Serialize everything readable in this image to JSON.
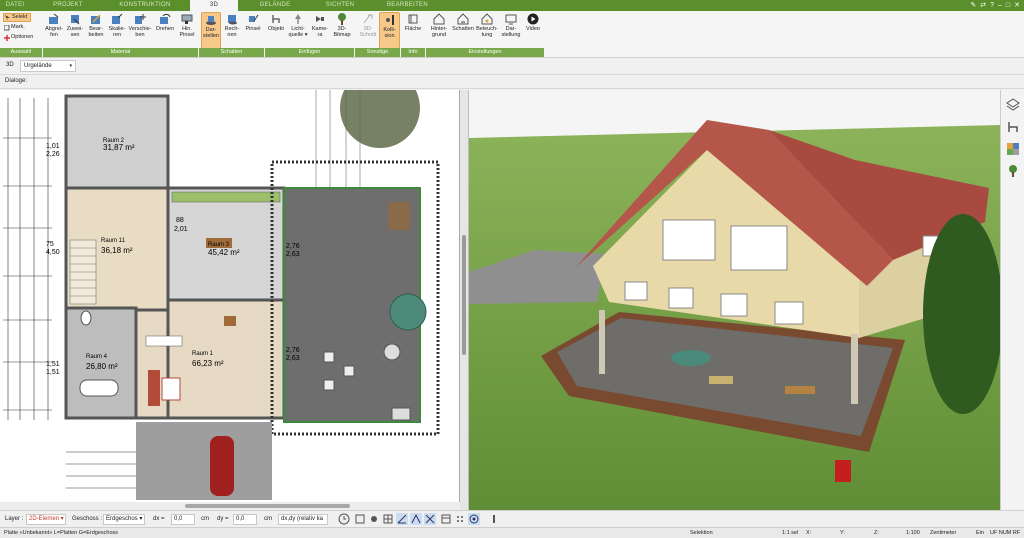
{
  "tabs": [
    {
      "label": "DATEI"
    },
    {
      "label": "PROJEKT"
    },
    {
      "label": "KONSTRUKTION"
    },
    {
      "label": "3D"
    },
    {
      "label": "GELÄNDE"
    },
    {
      "label": "SICHTEN"
    },
    {
      "label": "BEARBEITEN"
    }
  ],
  "window_controls": [
    "✎",
    "⇄",
    "?",
    "–",
    "□",
    "✕"
  ],
  "ribbon": {
    "selection": {
      "selekt": "Selekt",
      "mark": "Mark.",
      "optionen": "Optionen",
      "group": "Auswahl"
    },
    "material": {
      "group": "Material",
      "buttons": [
        "Abgrei-\nfen",
        "Zuwei-\nsen",
        "Bear-\nbeiten",
        "Skalie-\nren",
        "Verschie-\nben",
        "Drehen",
        "Hin.\nPinsel"
      ]
    },
    "schatten": {
      "group": "Schatten",
      "buttons": [
        "Dar-\nstellen",
        "Rech-\nnen",
        "Pinsel"
      ]
    },
    "einfuegen": {
      "group": "Einfügen",
      "buttons": [
        "Objekt",
        "Licht-\nquelle ▾",
        "Kame-\nra",
        "3D-\nBitmap"
      ]
    },
    "sonstige": {
      "group": "Sonstige",
      "buttons": [
        "3D-\nSchnitt",
        "Kolli-\nsion"
      ]
    },
    "info": {
      "group": "Info",
      "buttons": [
        "Fläche"
      ]
    },
    "einstellungen": {
      "group": "Einstellungen",
      "buttons": [
        "Hinter-\ngrund",
        "Schatten",
        "Beleuch-\ntung",
        "Dar-\nstellung",
        "Video"
      ]
    }
  },
  "view_row": {
    "label": "3D",
    "selected": "Urgelände"
  },
  "dialog_label": "Dialoge:",
  "plan": {
    "rooms": [
      {
        "name": "Raum 2",
        "area": "31,87 m²"
      },
      {
        "name": "Raum 11",
        "area": "36,18 m²"
      },
      {
        "name": "Raum 3",
        "area": "45,42 m²"
      },
      {
        "name": "Raum 1",
        "area": "66,23 m²"
      },
      {
        "name": "Raum 4",
        "area": "26,80 m²"
      }
    ],
    "dims_left": [
      "1,01",
      "2,26",
      "75",
      "4,50",
      "1,51",
      "1,51"
    ],
    "dims_mid": [
      "2,76",
      "2,63",
      "2,76",
      "2,63"
    ],
    "dim_small": [
      "88",
      "2,01"
    ]
  },
  "layerbar": {
    "layer_label": "Layer :",
    "layer_value": "2D-Elemen ▾",
    "geschoss_label": "Geschoss :",
    "geschoss_value": "Erdgeschos ▾",
    "dx_label": "dx =",
    "dx_value": "0,0",
    "dy_label": "dy =",
    "dy_value": "0,0",
    "unit": "cm",
    "mode_value": "dx,dy (relativ ka"
  },
  "statusbar": {
    "left": "Platte «Unbekannt» L=Platten G=Erdgeschoss",
    "selektion": "Selektion",
    "sel": "1:1 sel",
    "x": "X:",
    "y": "Y:",
    "z": "Z:",
    "scale": "1:100",
    "unit": "Zentimeter",
    "ein": "Ein",
    "flags": "UF  NUM  RF"
  },
  "colors": {
    "tab_green": "#5a8f2c",
    "group_green": "#79a84a",
    "highlight": "#f6c98b",
    "roof": "#b5564a",
    "grass": "#6f9d3f",
    "sky": "#f5f5f5"
  }
}
